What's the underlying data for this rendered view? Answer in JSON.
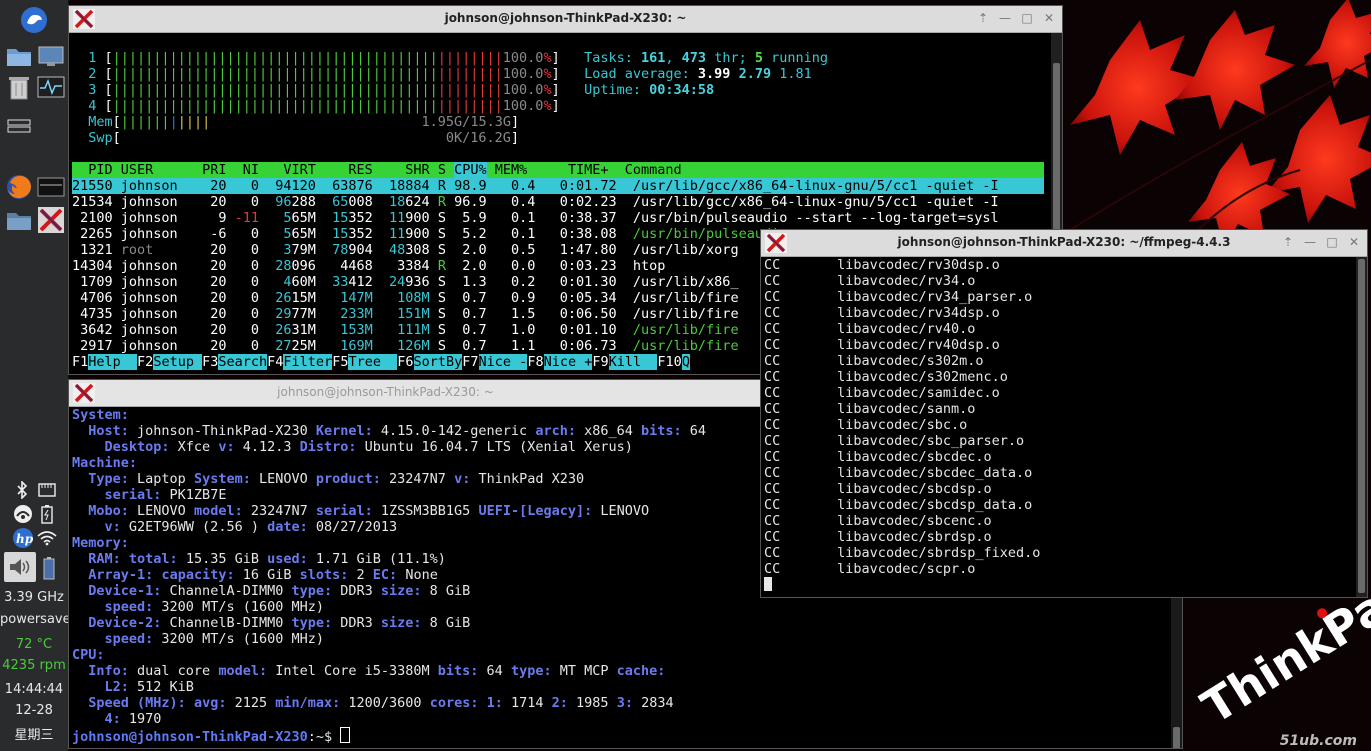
{
  "panel": {
    "cpu_freq": "3.39 GHz",
    "governor": "powersave",
    "temp": "72 °C",
    "fan": "4235 rpm",
    "time": "14:44:44",
    "date": "12-28",
    "weekday": "星期三",
    "icons": [
      "xfce-mouse-icon",
      "folder-icon",
      "display-icon",
      "trash-icon",
      "activity-monitor-icon",
      "window-switcher-icon",
      "firefox-icon",
      "terminal-icon",
      "folder-icon",
      "x-terminal-icon",
      "bluetooth-icon",
      "sdcard-icon",
      "network-icon",
      "battery-icon",
      "hp-icon",
      "wifi-icon",
      "volume-icon",
      "battery-icon"
    ]
  },
  "watermark": "51ub.com",
  "htop": {
    "title": "johnson@johnson-ThinkPad-X230: ~",
    "cpus": [
      {
        "id": "1",
        "pct": "100.0%"
      },
      {
        "id": "2",
        "pct": "100.0%"
      },
      {
        "id": "3",
        "pct": "100.0%"
      },
      {
        "id": "4",
        "pct": "100.0%"
      }
    ],
    "mem_label": "Mem",
    "mem_value": "1.95G/15.3G",
    "swp_label": "Swp",
    "swp_value": "0K/16.2G",
    "tasks_label": "Tasks:",
    "tasks": "161",
    "threads": "473",
    "thr_label": "thr;",
    "running": "5",
    "running_label": "running",
    "load_label": "Load average:",
    "load1": "3.99",
    "load5": "2.79",
    "load15": "1.81",
    "uptime_label": "Uptime:",
    "uptime": "00:34:58",
    "columns": [
      "PID",
      "USER",
      "PRI",
      "NI",
      "VIRT",
      "RES",
      "SHR",
      "S",
      "CPU%",
      "MEM%",
      "TIME+",
      "Command"
    ],
    "processes": [
      {
        "pid": "21550",
        "user": "johnson",
        "pri": "20",
        "ni": "0",
        "virt": "94120",
        "res": "63876",
        "shr": "18884",
        "s": "R",
        "cpu": "98.9",
        "mem": "0.4",
        "time": "0:01.72",
        "cmd": "/usr/lib/gcc/x86_64-linux-gnu/5/cc1 -quiet -I"
      },
      {
        "pid": "21534",
        "user": "johnson",
        "pri": "20",
        "ni": "0",
        "virt": "96288",
        "res": "65008",
        "shr": "18624",
        "s": "R",
        "cpu": "96.9",
        "mem": "0.4",
        "time": "0:02.23",
        "cmd": "/usr/lib/gcc/x86_64-linux-gnu/5/cc1 -quiet -I"
      },
      {
        "pid": "2100",
        "user": "johnson",
        "pri": "9",
        "ni": "-11",
        "virt": "565M",
        "res": "15352",
        "shr": "11900",
        "s": "S",
        "cpu": "5.9",
        "mem": "0.1",
        "time": "0:38.37",
        "cmd": "/usr/bin/pulseaudio --start --log-target=sysl"
      },
      {
        "pid": "2265",
        "user": "johnson",
        "pri": "-6",
        "ni": "0",
        "virt": "565M",
        "res": "15352",
        "shr": "11900",
        "s": "S",
        "cpu": "5.2",
        "mem": "0.1",
        "time": "0:38.08",
        "cmd": "/usr/bin/pulseaudio"
      },
      {
        "pid": "1321",
        "user": "root",
        "pri": "20",
        "ni": "0",
        "virt": "379M",
        "res": "78904",
        "shr": "48308",
        "s": "S",
        "cpu": "2.0",
        "mem": "0.5",
        "time": "1:47.80",
        "cmd": "/usr/lib/xorg"
      },
      {
        "pid": "14304",
        "user": "johnson",
        "pri": "20",
        "ni": "0",
        "virt": "28096",
        "res": "4468",
        "shr": "3384",
        "s": "R",
        "cpu": "2.0",
        "mem": "0.0",
        "time": "0:03.23",
        "cmd": "htop"
      },
      {
        "pid": "1709",
        "user": "johnson",
        "pri": "20",
        "ni": "0",
        "virt": "460M",
        "res": "33412",
        "shr": "24936",
        "s": "S",
        "cpu": "1.3",
        "mem": "0.2",
        "time": "0:01.30",
        "cmd": "/usr/lib/x86_"
      },
      {
        "pid": "4706",
        "user": "johnson",
        "pri": "20",
        "ni": "0",
        "virt": "2615M",
        "res": "147M",
        "shr": "108M",
        "s": "S",
        "cpu": "0.7",
        "mem": "0.9",
        "time": "0:05.34",
        "cmd": "/usr/lib/fire"
      },
      {
        "pid": "4735",
        "user": "johnson",
        "pri": "20",
        "ni": "0",
        "virt": "2977M",
        "res": "233M",
        "shr": "151M",
        "s": "S",
        "cpu": "0.7",
        "mem": "1.5",
        "time": "0:06.50",
        "cmd": "/usr/lib/fire"
      },
      {
        "pid": "3642",
        "user": "johnson",
        "pri": "20",
        "ni": "0",
        "virt": "2631M",
        "res": "153M",
        "shr": "111M",
        "s": "S",
        "cpu": "0.7",
        "mem": "1.0",
        "time": "0:01.10",
        "cmd": "/usr/lib/fire"
      },
      {
        "pid": "2917",
        "user": "johnson",
        "pri": "20",
        "ni": "0",
        "virt": "2725M",
        "res": "169M",
        "shr": "126M",
        "s": "S",
        "cpu": "0.7",
        "mem": "1.1",
        "time": "0:06.73",
        "cmd": "/usr/lib/fire"
      }
    ],
    "fkeys": [
      {
        "k": "F1",
        "l": "Help  "
      },
      {
        "k": "F2",
        "l": "Setup "
      },
      {
        "k": "F3",
        "l": "Search"
      },
      {
        "k": "F4",
        "l": "Filter"
      },
      {
        "k": "F5",
        "l": "Tree  "
      },
      {
        "k": "F6",
        "l": "SortBy"
      },
      {
        "k": "F7",
        "l": "Nice -"
      },
      {
        "k": "F8",
        "l": "Nice +"
      },
      {
        "k": "F9",
        "l": "Kill  "
      },
      {
        "k": "F10",
        "l": "Q"
      }
    ]
  },
  "inxi": {
    "title": "johnson@johnson-ThinkPad-X230: ~",
    "lines": [
      [
        [
          "l",
          "System:"
        ]
      ],
      [
        [
          "t",
          "  "
        ],
        [
          "l",
          "Host:"
        ],
        [
          "t",
          " johnson-ThinkPad-X230 "
        ],
        [
          "l",
          "Kernel:"
        ],
        [
          "t",
          " 4.15.0-142-generic "
        ],
        [
          "l",
          "arch:"
        ],
        [
          "t",
          " x86_64 "
        ],
        [
          "l",
          "bits:"
        ],
        [
          "t",
          " 64"
        ]
      ],
      [
        [
          "t",
          "    "
        ],
        [
          "l",
          "Desktop:"
        ],
        [
          "t",
          " Xfce "
        ],
        [
          "l",
          "v:"
        ],
        [
          "t",
          " 4.12.3 "
        ],
        [
          "l",
          "Distro:"
        ],
        [
          "t",
          " Ubuntu 16.04.7 LTS (Xenial Xerus)"
        ]
      ],
      [
        [
          "l",
          "Machine:"
        ]
      ],
      [
        [
          "t",
          "  "
        ],
        [
          "l",
          "Type:"
        ],
        [
          "t",
          " Laptop "
        ],
        [
          "l",
          "System:"
        ],
        [
          "t",
          " LENOVO "
        ],
        [
          "l",
          "product:"
        ],
        [
          "t",
          " 23247N7 "
        ],
        [
          "l",
          "v:"
        ],
        [
          "t",
          " ThinkPad X230"
        ]
      ],
      [
        [
          "t",
          "    "
        ],
        [
          "l",
          "serial:"
        ],
        [
          "t",
          " PK1ZB7E"
        ]
      ],
      [
        [
          "t",
          "  "
        ],
        [
          "l",
          "Mobo:"
        ],
        [
          "t",
          " LENOVO "
        ],
        [
          "l",
          "model:"
        ],
        [
          "t",
          " 23247N7 "
        ],
        [
          "l",
          "serial:"
        ],
        [
          "t",
          " 1ZSSM3BB1G5 "
        ],
        [
          "l",
          "UEFI-[Legacy]:"
        ],
        [
          "t",
          " LENOVO"
        ]
      ],
      [
        [
          "t",
          "    "
        ],
        [
          "l",
          "v:"
        ],
        [
          "t",
          " G2ET96WW (2.56 ) "
        ],
        [
          "l",
          "date:"
        ],
        [
          "t",
          " 08/27/2013"
        ]
      ],
      [
        [
          "l",
          "Memory:"
        ]
      ],
      [
        [
          "t",
          "  "
        ],
        [
          "l",
          "RAM:"
        ],
        [
          "t",
          " "
        ],
        [
          "l",
          "total:"
        ],
        [
          "t",
          " 15.35 GiB "
        ],
        [
          "l",
          "used:"
        ],
        [
          "t",
          " 1.71 GiB (11.1%)"
        ]
      ],
      [
        [
          "t",
          "  "
        ],
        [
          "l",
          "Array-1:"
        ],
        [
          "t",
          " "
        ],
        [
          "l",
          "capacity:"
        ],
        [
          "t",
          " 16 GiB "
        ],
        [
          "l",
          "slots:"
        ],
        [
          "t",
          " 2 "
        ],
        [
          "l",
          "EC:"
        ],
        [
          "t",
          " None"
        ]
      ],
      [
        [
          "t",
          "  "
        ],
        [
          "l",
          "Device-1:"
        ],
        [
          "t",
          " ChannelA-DIMM0 "
        ],
        [
          "l",
          "type:"
        ],
        [
          "t",
          " DDR3 "
        ],
        [
          "l",
          "size:"
        ],
        [
          "t",
          " 8 GiB"
        ]
      ],
      [
        [
          "t",
          "    "
        ],
        [
          "l",
          "speed:"
        ],
        [
          "t",
          " 3200 MT/s (1600 MHz)"
        ]
      ],
      [
        [
          "t",
          "  "
        ],
        [
          "l",
          "Device-2:"
        ],
        [
          "t",
          " ChannelB-DIMM0 "
        ],
        [
          "l",
          "type:"
        ],
        [
          "t",
          " DDR3 "
        ],
        [
          "l",
          "size:"
        ],
        [
          "t",
          " 8 GiB"
        ]
      ],
      [
        [
          "t",
          "    "
        ],
        [
          "l",
          "speed:"
        ],
        [
          "t",
          " 3200 MT/s (1600 MHz)"
        ]
      ],
      [
        [
          "l",
          "CPU:"
        ]
      ],
      [
        [
          "t",
          "  "
        ],
        [
          "l",
          "Info:"
        ],
        [
          "t",
          " dual core "
        ],
        [
          "l",
          "model:"
        ],
        [
          "t",
          " Intel Core i5-3380M "
        ],
        [
          "l",
          "bits:"
        ],
        [
          "t",
          " 64 "
        ],
        [
          "l",
          "type:"
        ],
        [
          "t",
          " MT MCP "
        ],
        [
          "l",
          "cache:"
        ]
      ],
      [
        [
          "t",
          "    "
        ],
        [
          "l",
          "L2:"
        ],
        [
          "t",
          " 512 KiB"
        ]
      ],
      [
        [
          "t",
          "  "
        ],
        [
          "l",
          "Speed (MHz):"
        ],
        [
          "t",
          " "
        ],
        [
          "l",
          "avg:"
        ],
        [
          "t",
          " 2125 "
        ],
        [
          "l",
          "min/max:"
        ],
        [
          "t",
          " 1200/3600 "
        ],
        [
          "l",
          "cores:"
        ],
        [
          "t",
          " "
        ],
        [
          "l",
          "1:"
        ],
        [
          "t",
          " 1714 "
        ],
        [
          "l",
          "2:"
        ],
        [
          "t",
          " 1985 "
        ],
        [
          "l",
          "3:"
        ],
        [
          "t",
          " 2834"
        ]
      ],
      [
        [
          "t",
          "    "
        ],
        [
          "l",
          "4:"
        ],
        [
          "t",
          " 1970"
        ]
      ]
    ],
    "prompt_user": "johnson@johnson-ThinkPad-X230",
    "prompt_path": ":~$ "
  },
  "ffmpeg": {
    "title": "johnson@johnson-ThinkPad-X230: ~/ffmpeg-4.4.3",
    "cc": "CC",
    "files": [
      "libavcodec/rv30dsp.o",
      "libavcodec/rv34.o",
      "libavcodec/rv34_parser.o",
      "libavcodec/rv34dsp.o",
      "libavcodec/rv40.o",
      "libavcodec/rv40dsp.o",
      "libavcodec/s302m.o",
      "libavcodec/s302menc.o",
      "libavcodec/samidec.o",
      "libavcodec/sanm.o",
      "libavcodec/sbc.o",
      "libavcodec/sbc_parser.o",
      "libavcodec/sbcdec.o",
      "libavcodec/sbcdec_data.o",
      "libavcodec/sbcdsp.o",
      "libavcodec/sbcdsp_data.o",
      "libavcodec/sbcenc.o",
      "libavcodec/sbrdsp.o",
      "libavcodec/sbrdsp_fixed.o",
      "libavcodec/scpr.o"
    ]
  },
  "window_buttons": {
    "up": "⇡",
    "min": "—",
    "max": "□",
    "close": "✕"
  }
}
